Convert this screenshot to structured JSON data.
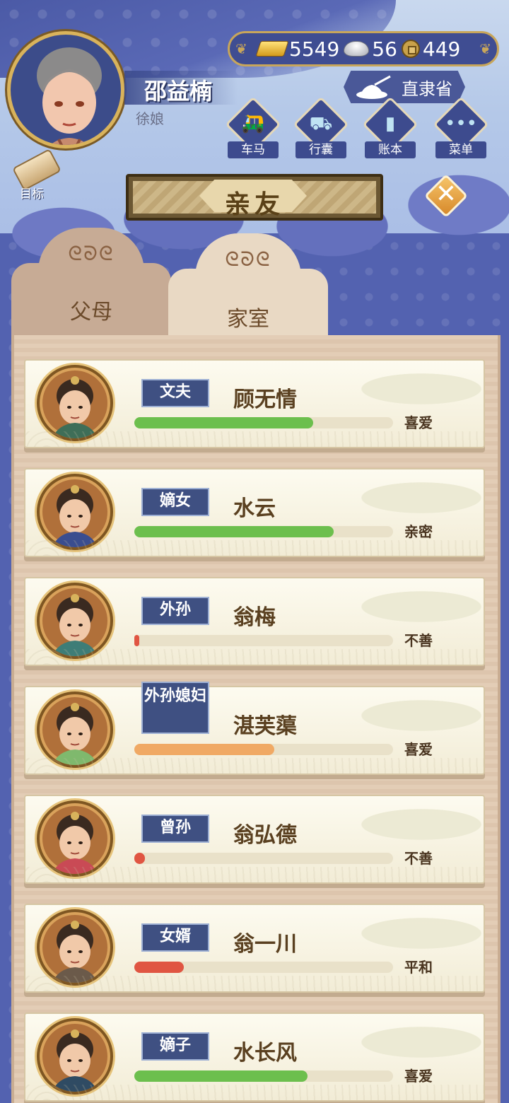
{
  "player": {
    "name": "邵益楠",
    "role": "徐娘"
  },
  "resources": {
    "gold": "5549",
    "silver": "56",
    "coins": "449"
  },
  "location": "直隶省",
  "menu": [
    {
      "label": "车马",
      "icon": "carriage-icon"
    },
    {
      "label": "行囊",
      "icon": "bundle-icon"
    },
    {
      "label": "账本",
      "icon": "ledger-icon"
    },
    {
      "label": "菜单",
      "icon": "more-icon"
    }
  ],
  "goal_label": "目标",
  "page_title": "亲友",
  "tabs": [
    {
      "label": "父母",
      "active": false
    },
    {
      "label": "家室",
      "active": true
    }
  ],
  "family": [
    {
      "relation": "文夫",
      "name": "顾无情",
      "status": "喜爱",
      "affinity": 0.69,
      "bar_color": "#6cbf4d"
    },
    {
      "relation": "嫡女",
      "name": "水云",
      "status": "亲密",
      "affinity": 0.77,
      "bar_color": "#6cbf4d"
    },
    {
      "relation": "外孙",
      "name": "翁梅",
      "status": "不善",
      "affinity": 0.02,
      "bar_color": "#e05542"
    },
    {
      "relation": "外孙媳妇",
      "name": "湛芙蕖",
      "status": "喜爱",
      "affinity": 0.54,
      "bar_color": "#f0a964"
    },
    {
      "relation": "曾孙",
      "name": "翁弘德",
      "status": "不善",
      "affinity": 0.04,
      "bar_color": "#e05542"
    },
    {
      "relation": "女婿",
      "name": "翁一川",
      "status": "平和",
      "affinity": 0.19,
      "bar_color": "#e05542"
    },
    {
      "relation": "嫡子",
      "name": "水长风",
      "status": "喜爱",
      "affinity": 0.67,
      "bar_color": "#6cbf4d"
    }
  ]
}
